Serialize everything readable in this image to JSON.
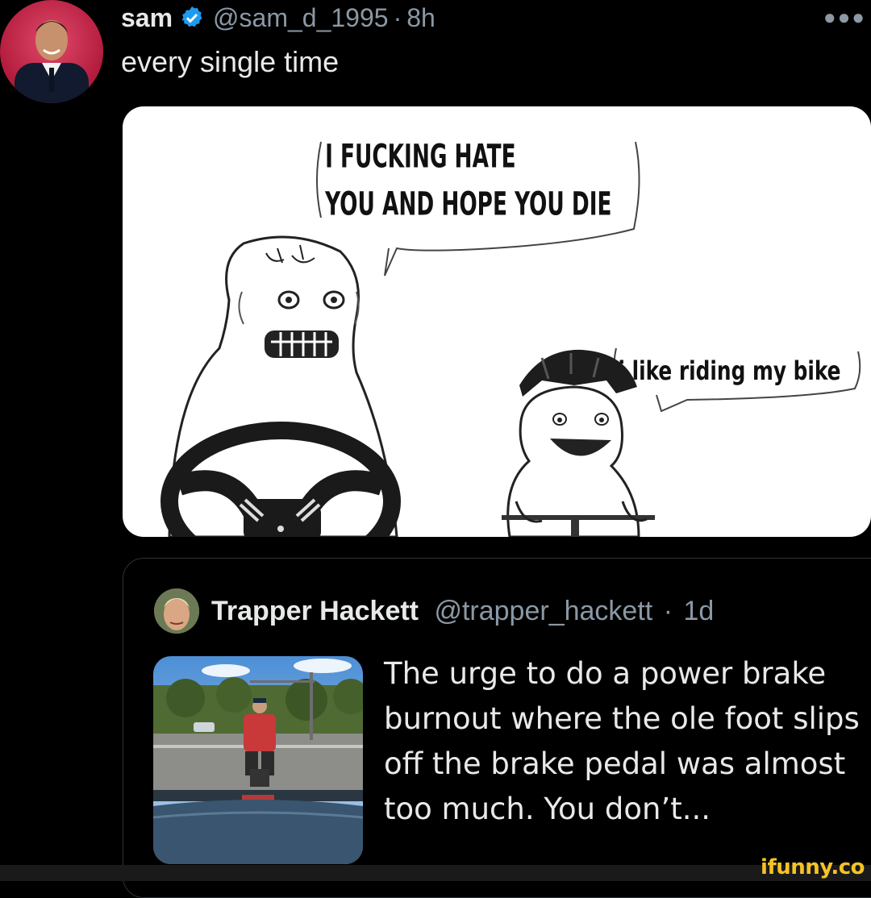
{
  "tweet": {
    "author_name": "sam",
    "handle": "@sam_d_1995",
    "separator": "·",
    "time": "8h",
    "text": "every single time",
    "more_icon": "more-horizontal-icon",
    "verified_color": "#1d9bf0"
  },
  "meme": {
    "driver_speech": "I FUCKING HATE YOU AND HOPE YOU DIE",
    "driver_line1": "I FUCKING HATE",
    "driver_line2": "YOU AND HOPE YOU DIE",
    "cyclist_speech": "i like riding my bike"
  },
  "quote": {
    "author_name": "Trapper Hackett",
    "handle": "@trapper_hackett",
    "separator": "·",
    "time": "1d",
    "text": "The urge to do a power brake burnout where the ole foot slips off the brake pedal was almost too much. You don’t..."
  },
  "watermark": "ifunny.co",
  "colors": {
    "background": "#000000",
    "text": "#e7e9ea",
    "secondary": "#8b98a5",
    "watermark": "#f6c325"
  }
}
